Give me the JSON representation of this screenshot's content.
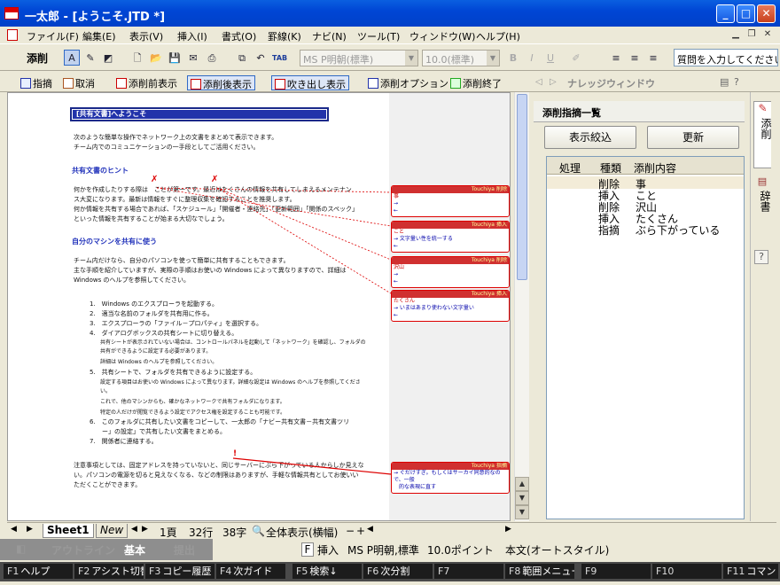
{
  "window": {
    "title": "一太郎 - [ようこそ.JTD *]"
  },
  "menu": [
    "ファイル(F)",
    "編集(E)",
    "表示(V)",
    "挿入(I)",
    "書式(O)",
    "罫線(K)",
    "ナビ(N)",
    "ツール(T)",
    "ウィンドウ(W)",
    "ヘルプ(H)"
  ],
  "toolbar": {
    "label": "添削",
    "font": "MS P明朝(標準)",
    "size": "10.0(標準)",
    "help_placeholder": "質問を入力してください"
  },
  "annobar": {
    "items": [
      "指摘",
      "取消",
      "添削前表示",
      "添削後表示",
      "吹き出し表示",
      "添削オプション",
      "添削終了"
    ],
    "knowledge": "ナレッジウィンドウ"
  },
  "doc": {
    "title": "[共有文書]へようこそ",
    "p1": [
      "次のような簡単な操作でネットワーク上の文書をまとめて表示できます。",
      "チーム内でのコミュニケーションの一手段としてご活用ください。"
    ],
    "h1": "共有文書のヒント",
    "p2": [
      "何かを作成したりする際は　ことが第一です。最近はたくさんの情報を共有してしまえるメンテナン",
      "ス大変になります。最新は情報をすぐに整理収集を確認することを推奨します。",
      "何か情報を共有する場合であれば、「スケジュール」「開催者・連絡先」「更新範囲」「関係のスペック」",
      "といった情報を共有することが始まる大切なでしょう。"
    ],
    "h2": "自分のマシンを共有に使う",
    "p3": [
      "チーム内だけなら、自分のパソコンを使って簡単に共有することもできます。",
      "主な手順を紹介していますが、実際の手順はお使いの Windows によって異なりますので、詳細は",
      "Windows のヘルプを参照してください。"
    ],
    "steps": [
      "1.　Windows のエクスプローラを起動する。",
      "2.　適当な名前のフォルダを共有用に作る。",
      "3.　エクスプローラの「ファイル－プロパティ」を選択する。",
      "4.　ダイアログボックスの共有シートに切り替える。",
      "　　共有シートが表示されていない場合は、コントロールパネルを起動して「ネットワーク」を確認し、フォルダの",
      "　　共有ができるように設定する必要があります。",
      "　　詳細は Windows のヘルプを参照してください。",
      "5.　共有シートで、フォルダを共有できるように設定する。",
      "　　設定する項目はお使いの Windows によって異なります。詳細な設定は Windows のヘルプを参照してくださ",
      "　　い。",
      "　　これで、他のマシンからも、確かなネットワークで共有フォルダになります。",
      "　　特定の人だけが閲覧できるよう設定でアクセス権を設定することも可能です。",
      "6.　このフォルダに共有したい文書をコピーして、一太郎の「ナビー共有文書－共有文書ツリ",
      "　　ー」の設定」で共有したい文書をまとめる。",
      "7.　関係者に連絡する。"
    ],
    "p4": [
      "注意事項としては、固定アドレスを持っていないと、同じサーバーにぶら下がっている人からしか見えな",
      "い。パソコンの電源を切ると見えなくなる、などの制限はありますが、手軽な情報共有としてお使いい",
      "ただくことができます。"
    ]
  },
  "balloons": [
    {
      "type": "削除",
      "user": "Touchiya",
      "l1": "事",
      "l2": "→",
      "l3": "←"
    },
    {
      "type": "挿入",
      "user": "Touchiya",
      "l1": "こと",
      "l2": "→ 文字量い性を統一する",
      "l3": "←"
    },
    {
      "type": "削除",
      "user": "Touchiya",
      "l1": "沢山",
      "l2": "→",
      "l3": "←"
    },
    {
      "type": "挿入",
      "user": "Touchiya",
      "l1": "たくさん",
      "l2": "→ いまはあまり使わない文字量い",
      "l3": "←"
    },
    {
      "type": "指摘",
      "user": "Touchiya",
      "l1": "",
      "l2": "→ ぐだけすぎ。もしくはサーカイ同意的なので、一般",
      "l3": "　的な表現に直す"
    }
  ],
  "panel": {
    "title": "添削指摘一覧",
    "btn_filter": "表示絞込",
    "btn_update": "更新",
    "cols": [
      "処理",
      "種類",
      "添削内容"
    ],
    "rows": [
      [
        "",
        "削除",
        "事"
      ],
      [
        "",
        "挿入",
        "こと"
      ],
      [
        "",
        "削除",
        "沢山"
      ],
      [
        "",
        "挿入",
        "たくさん"
      ],
      [
        "",
        "指摘",
        "ぶら下がっている"
      ]
    ]
  },
  "sidetabs": [
    "添削",
    "辞書"
  ],
  "sheet": {
    "tab1": "Sheet1",
    "tab2": "New",
    "page": "1頁",
    "line": "32行",
    "col": "38字",
    "view": "全体表示(横幅)"
  },
  "modes": [
    "アウトライン",
    "基本",
    "提出"
  ],
  "status": {
    "mode": "挿入",
    "font": "MS P明朝,標準",
    "size": "10.0ポイント",
    "style": "本文(オートスタイル)"
  },
  "fkeys": [
    [
      "F1",
      "ヘルプ"
    ],
    [
      "F2",
      "アシスト切替"
    ],
    [
      "F3",
      "コピー履歴"
    ],
    [
      "F4",
      "次ガイド"
    ],
    [
      "F5",
      "検索↓"
    ],
    [
      "F6",
      "次分割"
    ],
    [
      "F7",
      ""
    ],
    [
      "F8",
      "範囲メニュー"
    ],
    [
      "F9",
      ""
    ],
    [
      "F10",
      ""
    ],
    [
      "F11",
      "コマンド"
    ]
  ]
}
